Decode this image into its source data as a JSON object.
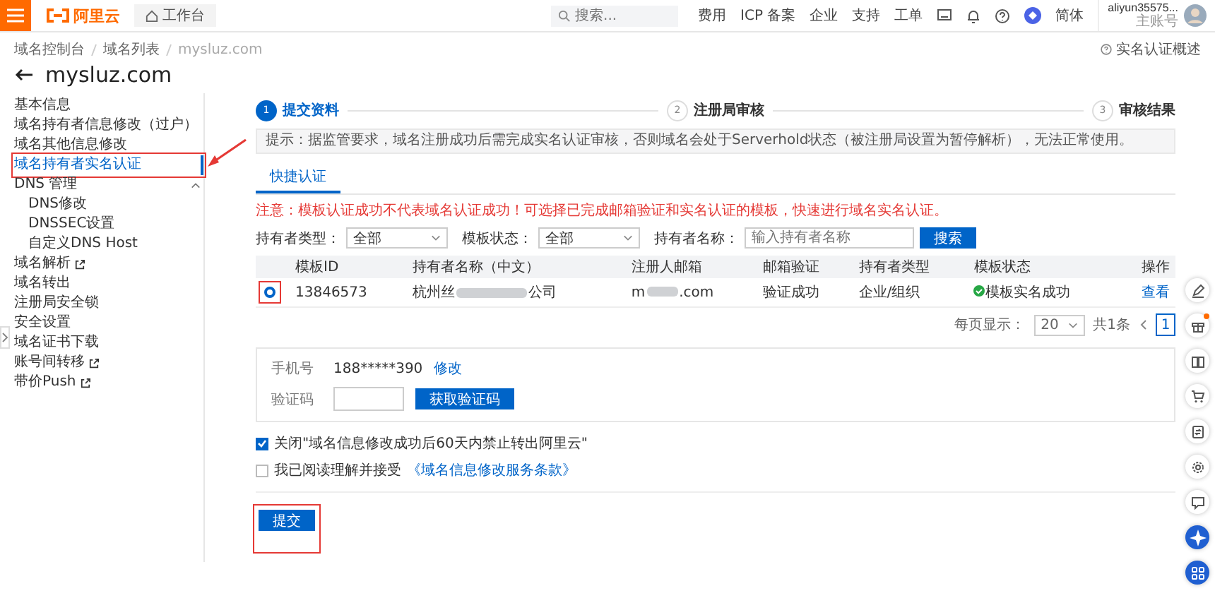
{
  "header": {
    "logo": "阿里云",
    "workbench": "工作台",
    "search": {
      "placeholder": "搜索..."
    },
    "links": [
      "费用",
      "ICP 备案",
      "企业",
      "支持",
      "工单"
    ],
    "language": "简体",
    "account": {
      "name": "aliyun35575...",
      "role": "主账号"
    }
  },
  "breadcrumb": [
    "域名控制台",
    "域名列表",
    "mysluz.com"
  ],
  "title": "mysluz.com",
  "help_link": "实名认证概述",
  "sidebar": {
    "items": [
      {
        "label": "基本信息",
        "selected": false,
        "external": false,
        "highlighted": false
      },
      {
        "label": "域名持有者信息修改（过户）",
        "selected": false,
        "external": false,
        "highlighted": false
      },
      {
        "label": "域名其他信息修改",
        "selected": false,
        "external": false,
        "highlighted": false
      },
      {
        "label": "域名持有者实名认证",
        "selected": true,
        "external": false,
        "highlighted": true
      },
      {
        "label": "DNS 管理",
        "selected": false,
        "external": false,
        "highlighted": false,
        "expanded": true,
        "children": [
          {
            "label": "DNS修改",
            "selected": false
          },
          {
            "label": "DNSSEC设置",
            "selected": false
          },
          {
            "label": "自定义DNS Host",
            "selected": false
          }
        ]
      },
      {
        "label": "域名解析",
        "selected": false,
        "external": true,
        "highlighted": false
      },
      {
        "label": "域名转出",
        "selected": false,
        "external": false,
        "highlighted": false
      },
      {
        "label": "注册局安全锁",
        "selected": false,
        "external": false,
        "highlighted": false
      },
      {
        "label": "安全设置",
        "selected": false,
        "external": false,
        "highlighted": false
      },
      {
        "label": "域名证书下载",
        "selected": false,
        "external": false,
        "highlighted": false
      },
      {
        "label": "账号间转移",
        "selected": false,
        "external": true,
        "highlighted": false
      },
      {
        "label": "带价Push",
        "selected": false,
        "external": true,
        "highlighted": false
      }
    ]
  },
  "steps": [
    {
      "number": "1",
      "label": "提交资料",
      "selected": true
    },
    {
      "number": "2",
      "label": "注册局审核",
      "selected": false
    },
    {
      "number": "3",
      "label": "审核结果",
      "selected": false
    }
  ],
  "notice": "提示：据监管要求，域名注册成功后需完成实名认证审核，否则域名会处于Serverhold状态（被注册局设置为暂停解析），无法正常使用。",
  "tabs": [
    {
      "label": "快捷认证",
      "selected": true
    }
  ],
  "warning": "注意：模板认证成功不代表域名认证成功！可选择已完成邮箱验证和实名认证的模板，快速进行域名实名认证。",
  "filters": [
    {
      "label": "持有者类型：",
      "kind": "select",
      "value": "全部"
    },
    {
      "label": "模板状态：",
      "kind": "select",
      "value": "全部"
    },
    {
      "label": "持有者名称：",
      "kind": "input",
      "placeholder": "输入持有者名称"
    }
  ],
  "search_button": "搜索",
  "table": {
    "columns": [
      "模板ID",
      "持有者名称（中文）",
      "注册人邮箱",
      "邮箱验证",
      "持有者类型",
      "模板状态",
      "操作"
    ],
    "rows": [
      {
        "selected": true,
        "highlighted": true,
        "id": "13846573",
        "name_start": "杭州丝",
        "name_end": "公司",
        "email_start": "m",
        "email_end": ".com",
        "email_verify": "验证成功",
        "holder_type": "企业/组织",
        "status": "模板实名成功",
        "status_ok": true,
        "action": "查看"
      }
    ]
  },
  "pagination": {
    "page_size_label": "每页显示：",
    "page_size": "20",
    "total": "共1条",
    "pages": [
      {
        "label": "1",
        "selected": true
      }
    ]
  },
  "verify": {
    "phone_label": "手机号",
    "phone": "188*****390",
    "change": "修改",
    "code_label": "验证码",
    "get_code": "获取验证码"
  },
  "agreements": [
    {
      "checked": true,
      "text": "关闭\"域名信息修改成功后60天内禁止转出阿里云\""
    },
    {
      "checked": false,
      "text": "我已阅读理解并接受",
      "link": "《域名信息修改服务条款》"
    }
  ],
  "submit": {
    "label": "提交",
    "highlighted": true
  }
}
